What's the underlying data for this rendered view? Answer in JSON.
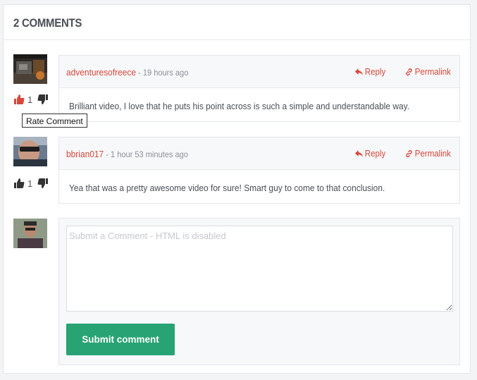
{
  "comments_section": {
    "title": "2 COMMENTS",
    "tooltip": "Rate Comment",
    "comments": [
      {
        "author": "adventuresofreece",
        "separator": " - ",
        "time": "19 hours ago",
        "reply_label": "Reply",
        "permalink_label": "Permalink",
        "votes": "1",
        "body": "Brilliant video, I love that he puts his point across is such a simple and understandable way."
      },
      {
        "author": "bbrian017",
        "separator": " - ",
        "time": "1 hour 53 minutes ago",
        "reply_label": "Reply",
        "permalink_label": "Permalink",
        "votes": "1",
        "body": "Yea that was a pretty awesome video for sure! Smart guy to come to that conclusion."
      }
    ],
    "compose": {
      "placeholder": "Submit a Comment - HTML is disabled",
      "submit_label": "Submit comment"
    }
  },
  "colors": {
    "accent_red": "#d9473a",
    "submit_green": "#27a374"
  }
}
